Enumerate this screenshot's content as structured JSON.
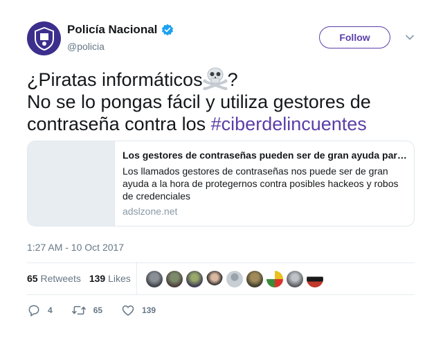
{
  "author": {
    "name": "Policía Nacional",
    "handle": "@policia",
    "verified": true,
    "avatar_color": "#3b2e8c"
  },
  "follow_label": "Follow",
  "tweet": {
    "line1_prefix": "¿Piratas informáticos",
    "line1_emoji": "skull-crossbones-icon",
    "line1_suffix": "?",
    "line2": "No se lo pongas fácil y utiliza gestores de",
    "line3_prefix": "contraseña contra los ",
    "hashtag": "#ciberdelincuentes"
  },
  "card": {
    "title": "Los gestores de contraseñas pueden ser de gran ayuda para evitar robos",
    "description": "Los llamados gestores de contraseñas nos puede ser de gran ayuda a la hora de protegernos contra posibles hackeos y robos de credenciales",
    "domain": "adslzone.net"
  },
  "timestamp": "1:27 AM - 10 Oct 2017",
  "stats": {
    "retweets_count": "65",
    "retweets_label": "Retweets",
    "likes_count": "139",
    "likes_label": "Likes"
  },
  "actions": {
    "replies": "4",
    "retweets": "65",
    "likes": "139"
  },
  "colors": {
    "accent": "#5b3ea8",
    "muted": "#657786"
  }
}
